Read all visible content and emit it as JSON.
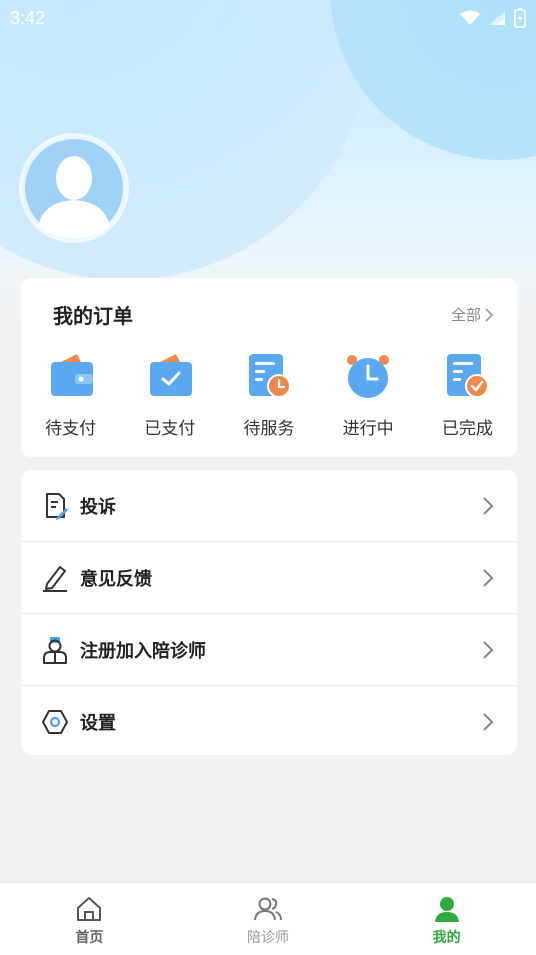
{
  "status_bar": {
    "time": "3:42"
  },
  "orders": {
    "title": "我的订单",
    "all_label": "全部",
    "items": [
      {
        "label": "待支付",
        "icon": "wallet-icon"
      },
      {
        "label": "已支付",
        "icon": "wallet-check-icon"
      },
      {
        "label": "待服务",
        "icon": "document-clock-icon"
      },
      {
        "label": "进行中",
        "icon": "alarm-clock-icon"
      },
      {
        "label": "已完成",
        "icon": "document-check-icon"
      }
    ]
  },
  "menu": {
    "items": [
      {
        "label": "投诉",
        "icon": "complaint-document-icon"
      },
      {
        "label": "意见反馈",
        "icon": "pencil-icon"
      },
      {
        "label": "注册加入陪诊师",
        "icon": "doctor-icon"
      },
      {
        "label": "设置",
        "icon": "hexagon-settings-icon"
      }
    ]
  },
  "tabbar": {
    "items": [
      {
        "label": "首页",
        "icon": "home-icon",
        "active": false
      },
      {
        "label": "陪诊师",
        "icon": "people-icon",
        "active": false
      },
      {
        "label": "我的",
        "icon": "person-icon",
        "active": true
      }
    ]
  },
  "colors": {
    "accent_active": "#2eab3f",
    "order_icon_blue": "#5aa9f0",
    "order_icon_orange": "#f08a4b",
    "tab_inactive": "#888888"
  }
}
